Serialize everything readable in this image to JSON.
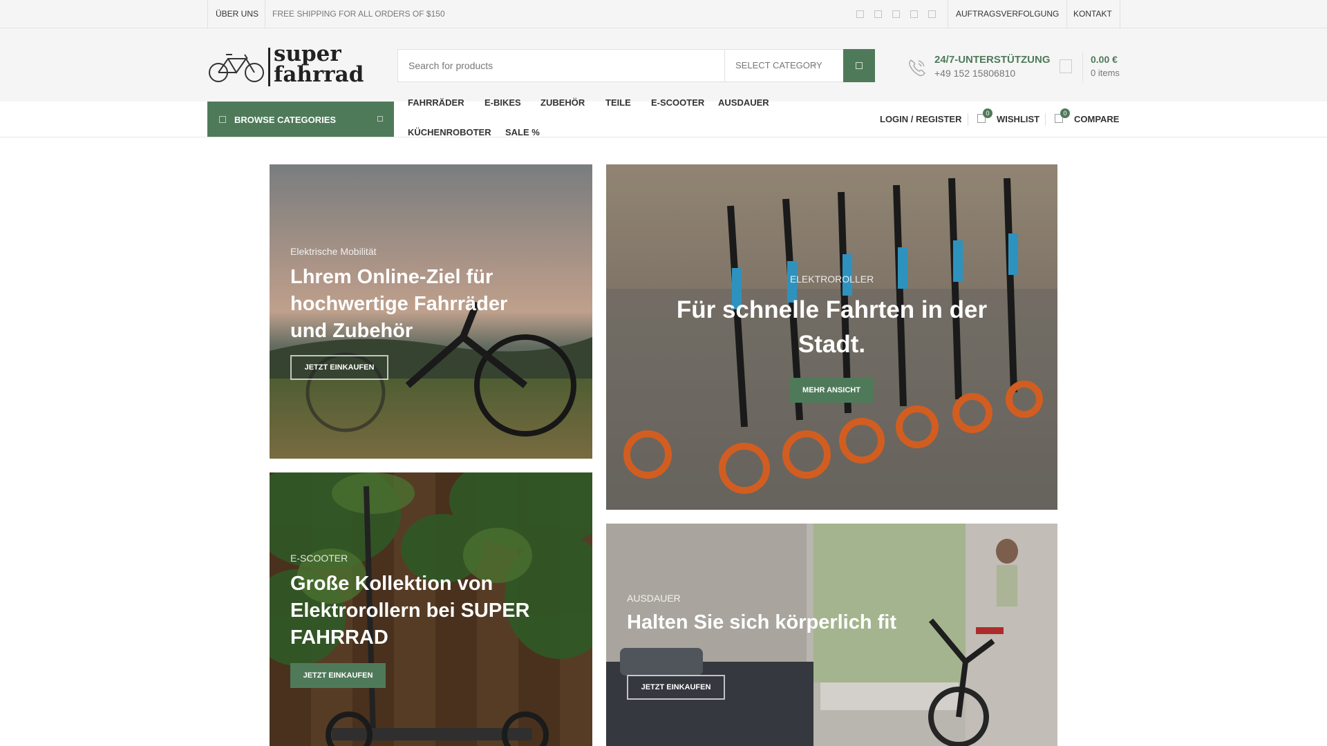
{
  "topbar": {
    "about": "ÜBER UNS",
    "shipping": "FREE SHIPPING FOR ALL ORDERS OF $150",
    "tracking": "AUFTRAGSVERFOLGUNG",
    "contact": "KONTAKT",
    "social_icons": [
      "social-icon",
      "social-icon",
      "social-icon",
      "social-icon",
      "social-icon"
    ]
  },
  "header": {
    "logo": {
      "line1": "super",
      "line2": "fahrrad"
    },
    "search": {
      "placeholder": "Search for products",
      "category": "SELECT CATEGORY"
    },
    "support": {
      "title": "24/7-UNTERSTÜTZUNG",
      "phone": "+49 152 15806810"
    },
    "cart": {
      "total": "0.00 €",
      "items": "0 items"
    }
  },
  "nav": {
    "browse_label": "BROWSE CATEGORIES",
    "menu": [
      "FAHRRÄDER",
      "E-BIKES",
      "ZUBEHÖR",
      "TEILE",
      "E-SCOOTER",
      "AUSDAUER",
      "KÜCHENROBOTER",
      "SALE %"
    ],
    "login": "LOGIN / REGISTER",
    "wishlist": {
      "label": "WISHLIST",
      "count": "0"
    },
    "compare": {
      "label": "COMPARE",
      "count": "0"
    }
  },
  "banners": {
    "b1": {
      "subtitle": "Elektrische Mobilität",
      "title": "Lhrem Online-Ziel für hochwertige Fahrräder und Zubehör",
      "button": "JETZT EINKAUFEN"
    },
    "b2": {
      "subtitle": "ELEKTROROLLER",
      "title": "Für schnelle Fahrten in der Stadt.",
      "button": "MEHR ANSICHT"
    },
    "b3": {
      "subtitle": "E-SCOOTER",
      "title": "Große Kollektion von Elektrorollern bei SUPER FAHRRAD",
      "button": "JETZT EINKAUFEN"
    },
    "b4": {
      "subtitle": "AUSDAUER",
      "title": "Halten Sie sich körperlich fit",
      "button": "JETZT EINKAUFEN"
    }
  },
  "colors": {
    "accent": "#4f7a5a",
    "topbar_bg": "#f5f5f5"
  }
}
